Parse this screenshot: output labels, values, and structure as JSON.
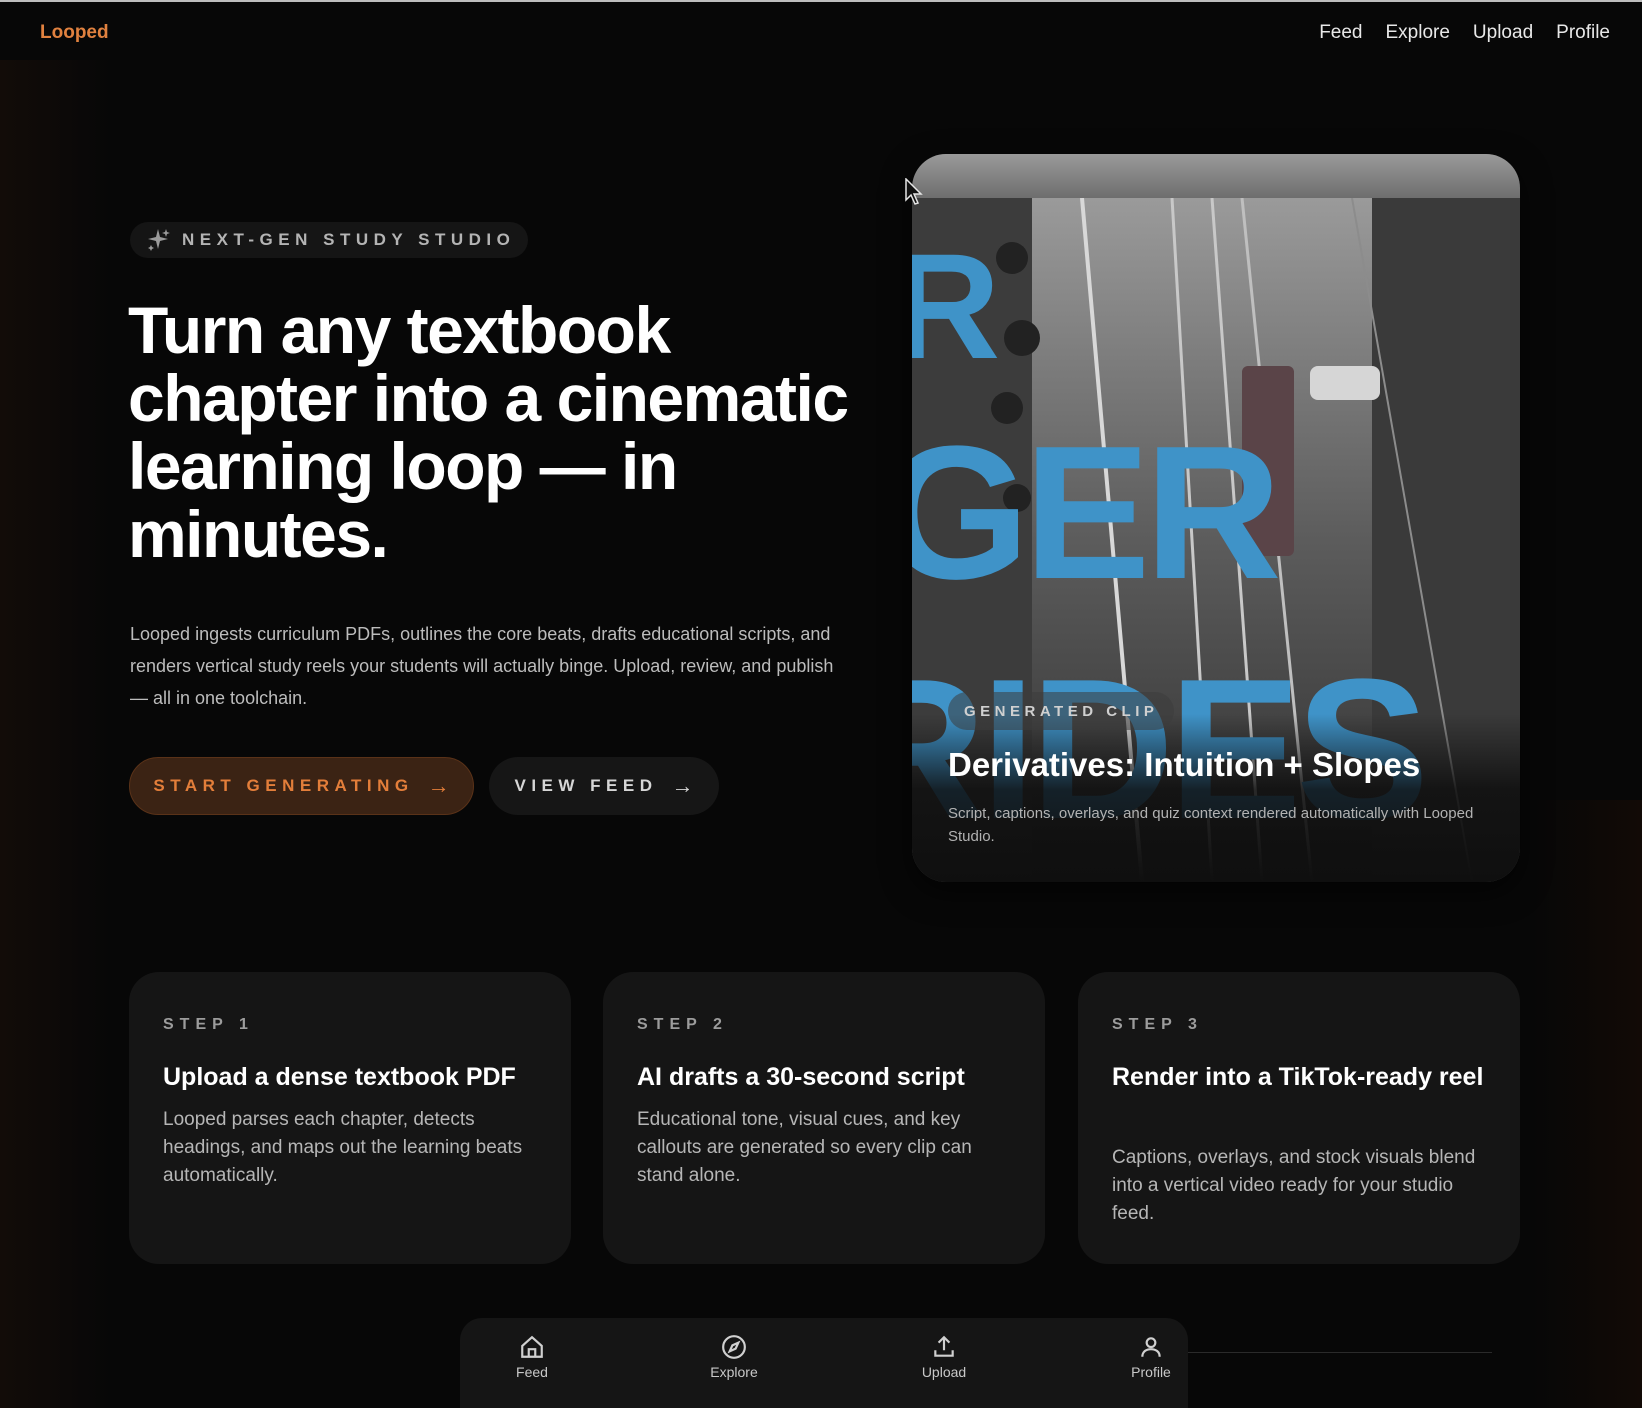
{
  "brand": "Looped",
  "top_nav": [
    "Feed",
    "Explore",
    "Upload",
    "Profile"
  ],
  "hero": {
    "badge": "NEXT-GEN STUDY STUDIO",
    "headline": "Turn any textbook chapter into a cinematic learning loop — in minutes.",
    "lede": "Looped ingests curriculum PDFs, outlines the core beats, drafts educational scripts, and renders vertical study reels your students will actually binge. Upload, review, and publish — all in one toolchain.",
    "primary_cta": "START GENERATING",
    "secondary_cta": "VIEW FEED"
  },
  "preview": {
    "overlay_text": [
      "R",
      "GER",
      "RIDES"
    ],
    "pill": "GENERATED CLIP",
    "title": "Derivatives: Intuition + Slopes",
    "description": "Script, captions, overlays, and quiz context rendered automatically with Looped Studio."
  },
  "steps": [
    {
      "label": "STEP 1",
      "title": "Upload a dense textbook PDF",
      "body": "Looped parses each chapter, detects headings, and maps out the learning beats automatically."
    },
    {
      "label": "STEP 2",
      "title": "AI drafts a 30-second script",
      "body": "Educational tone, visual cues, and key callouts are generated so every clip can stand alone."
    },
    {
      "label": "STEP 3",
      "title": "Render into a TikTok-ready reel",
      "body": "Captions, overlays, and stock visuals blend into a vertical video ready for your studio feed."
    }
  ],
  "tab_bar": [
    {
      "label": "Feed",
      "icon": "home-icon"
    },
    {
      "label": "Explore",
      "icon": "compass-icon"
    },
    {
      "label": "Upload",
      "icon": "upload-icon"
    },
    {
      "label": "Profile",
      "icon": "user-icon"
    }
  ],
  "colors": {
    "accent": "#e0813f",
    "background": "#070707",
    "card": "#151515",
    "overlay_text": "#3f93c8"
  }
}
